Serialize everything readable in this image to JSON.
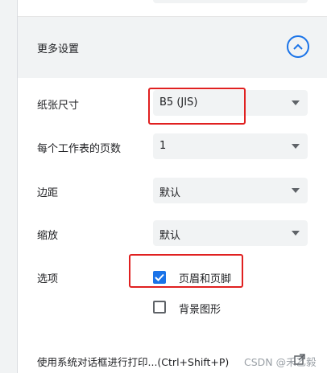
{
  "more_settings": {
    "label": "更多设置",
    "toggle_icon": "chevron-up-icon"
  },
  "paper_size": {
    "label": "纸张尺寸",
    "value": "B5 (JIS)"
  },
  "pages_per_sheet": {
    "label": "每个工作表的页数",
    "value": "1"
  },
  "margins": {
    "label": "边距",
    "value": "默认"
  },
  "scale": {
    "label": "缩放",
    "value": "默认"
  },
  "options": {
    "label": "选项",
    "headers_footers": {
      "label": "页眉和页脚",
      "checked": true
    },
    "background_graphics": {
      "label": "背景图形",
      "checked": false
    }
  },
  "system_dialog": {
    "label": "使用系统对话框进行打印...(Ctrl+Shift+P)",
    "icon": "open-in-new-icon"
  },
  "watermark": "CSDN @禾乙毅",
  "colors": {
    "accent": "#1a73e8",
    "highlight_box": "#e02020",
    "field_bg": "#f1f3f4"
  }
}
